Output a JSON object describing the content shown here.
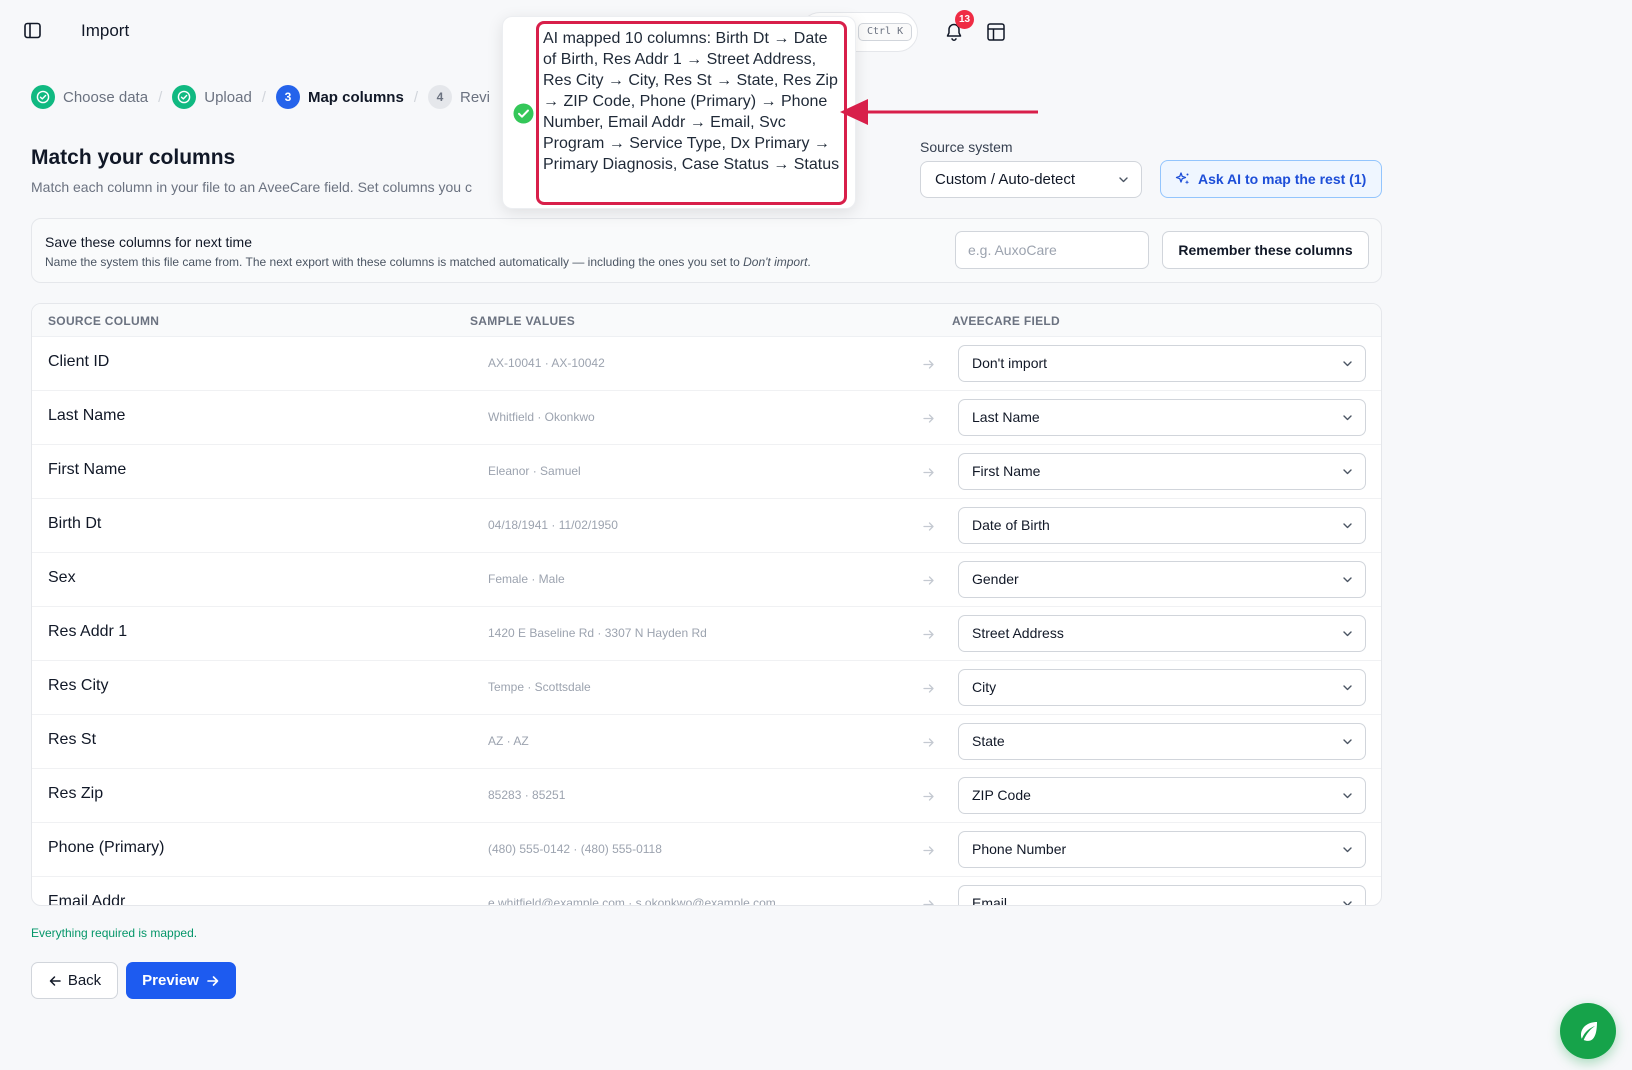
{
  "header": {
    "title": "Import",
    "search_shortcut": "Ctrl K",
    "notification_count": "13"
  },
  "steps": [
    {
      "label": "Choose data",
      "state": "done",
      "number": "1"
    },
    {
      "label": "Upload",
      "state": "done",
      "number": "2"
    },
    {
      "label": "Map columns",
      "state": "active",
      "number": "3"
    },
    {
      "label": "Revi",
      "state": "pending",
      "number": "4"
    }
  ],
  "main": {
    "title": "Match your columns",
    "subtitle": "Match each column in your file to an AveeCare field. Set columns you c"
  },
  "source_system": {
    "label": "Source system",
    "value": "Custom / Auto-detect"
  },
  "ai_button": {
    "label": "Ask AI to map the rest (1)"
  },
  "save_panel": {
    "title": "Save these columns for next time",
    "description": "Name the system this file came from. The next export with these columns is matched automatically — including the ones you set to ",
    "description_emphasis": "Don't import",
    "description_end": ".",
    "input_placeholder": "e.g. AuxoCare",
    "input_value": "",
    "remember_label": "Remember these columns"
  },
  "table": {
    "headers": {
      "source": "SOURCE COLUMN",
      "sample": "SAMPLE VALUES",
      "field": "AVEECARE FIELD"
    },
    "rows": [
      {
        "source": "Client ID",
        "sample": "AX-10041 · AX-10042",
        "field": "Don't import"
      },
      {
        "source": "Last Name",
        "sample": "Whitfield · Okonkwo",
        "field": "Last Name"
      },
      {
        "source": "First Name",
        "sample": "Eleanor · Samuel",
        "field": "First Name"
      },
      {
        "source": "Birth Dt",
        "sample": "04/18/1941 · 11/02/1950",
        "field": "Date of Birth"
      },
      {
        "source": "Sex",
        "sample": "Female · Male",
        "field": "Gender"
      },
      {
        "source": "Res Addr 1",
        "sample": "1420 E Baseline Rd · 3307 N Hayden Rd",
        "field": "Street Address"
      },
      {
        "source": "Res City",
        "sample": "Tempe · Scottsdale",
        "field": "City"
      },
      {
        "source": "Res St",
        "sample": "AZ · AZ",
        "field": "State"
      },
      {
        "source": "Res Zip",
        "sample": "85283 · 85251",
        "field": "ZIP Code"
      },
      {
        "source": "Phone (Primary)",
        "sample": "(480) 555-0142 · (480) 555-0118",
        "field": "Phone Number"
      },
      {
        "source": "Email Addr",
        "sample": "e.whitfield@example.com · s.okonkwo@example.com",
        "field": "Email"
      }
    ]
  },
  "status_message": "Everything required is mapped.",
  "footer": {
    "back_label": "Back",
    "preview_label": "Preview"
  },
  "toast": {
    "message": "AI mapped 10 columns: Birth Dt → Date of Birth, Res Addr 1 → Street Address, Res City → City, Res St → State, Res Zip → ZIP Code, Phone (Primary) → Phone Number, Email Addr → Email, Svc Program → Service Type, Dx Primary → Primary Diagnosis, Case Status → Status"
  },
  "colors": {
    "accent": "#1d5bf0",
    "success": "#10b981",
    "callout": "#d81f4a",
    "badge": "#ef2c44"
  },
  "icons": {
    "sidebar_toggle": "sidebar-toggle-icon",
    "bell": "bell-icon",
    "layout": "layout-icon",
    "check": "check-circle-icon",
    "sparkle": "sparkle-icon",
    "chevron": "chevron-down-icon",
    "arrow_right": "arrow-right-icon",
    "arrow_left": "arrow-left-icon",
    "leaf": "leaf-icon"
  }
}
